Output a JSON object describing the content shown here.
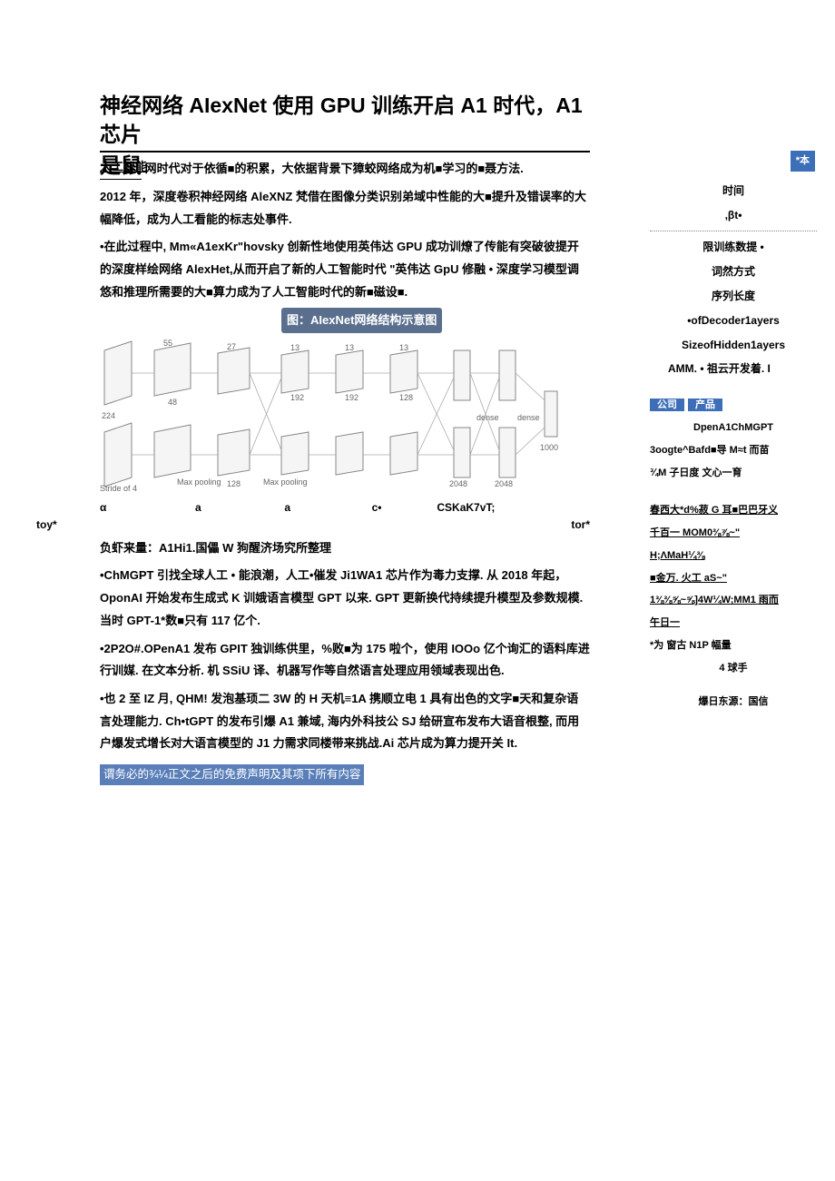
{
  "main": {
    "title": "神经网络 AIexNet 使用 GPU 训练开启 A1 时代，A1 芯片",
    "title2": "是鼠",
    "title2_overlay": "人工智能",
    "p1": "网时代对于依循■的积累，大依据背景下獐蛟网络成为机■学习的■聂方法.",
    "p2": "2012 年，深度卷积神经网络 AleXNZ 梵借在图像分类识别弟域中性能的大■提升及错误率的大幅降低，成为人工看能的标志处事件.",
    "p3": "•在此过程中, Mm«A1exKr\"hovsky 创新性地使用英伟达 GPU 成功训燎了传能有突破彼提开的深度样绘网络 AlexHet,从而开启了新的人工智能时代 \"英伟达 GpU 修融 • 深度学习模型调悠和推理所需要的大■算力成为了人工智能时代的新■磁设■.",
    "diagram_title": "图：AIexNet网络结构示意图",
    "tensor_row1": {
      "c1": "toy*",
      "c2": "α",
      "c3": "a",
      "c4": "a",
      "c5": "c•",
      "c6": "CSKaK7vT;",
      "c7": "tor*"
    },
    "source": "负虾来量：A1Hi1.国儡 W 狗醒济场究所整理",
    "p4": "•ChMGPT 引找全球人工 • 能浪潮，人工•催发 Ji1WA1 芯片作为毒力支撑. 从 2018 年起，OponAI 开始发布生成式 K 训娥语言模型 GPT 以来. GPT 更新换代持续提升模型及参数规模. 当时 GPT-1*数■只有 117 亿个.",
    "p5": "•2P2O#.OPenA1 发布 GPIT 独训练供里，%败■为 175 啦个，使用 IOOo 亿个询汇的语料库进行训媒. 在文本分析. 机 SSiU 译、机器写作等自然语言处理应用领域表现出色.",
    "p6": "•也 2 至 IZ 月, QHM! 发泡基顼二 3W 的 H 天机≡1A 携顺立电 1 具有出色的文字■天和复杂语言处理能力. Ch•tGPT 的发布引爆 A1 兼域, 海内外科技公 SJ 给研宣布发布大语音根整, 而用户爆发式增长对大语言模型的 J1 力需求同楼带来挑战.Ai 芯片成为算力提开关 It.",
    "highlight": "谓务必的¾¼正文之后的免费声明及其项下所有内容"
  },
  "sidebar": {
    "badge": "*本",
    "rows": [
      "时间",
      ",βt•"
    ],
    "after_divider": [
      "限训练数提 •",
      "词然方式",
      "序列长度"
    ],
    "bold_rows": [
      "•ofDecoder1ayers",
      "SizeofHidden1ayers"
    ],
    "amm": "AMM. • 祖云开发着. I",
    "header_cols": {
      "c1": "公司",
      "c2": "产品"
    },
    "table": [
      "DpenA1ChMGPT",
      "3oogte^Bafd■导 M≈t 而苗",
      "¾M 子日度  文心一育"
    ],
    "links": [
      "春西大*d%菽 G 耳■巴巴牙义",
      "千百一 MOM0⅜⅞~\"",
      "H;ΛMaH¼⅜",
      "■金万. 火工 aS~\"",
      "1⅜⅜⅝~⅝]4W¼W;MM1 雨而",
      "午日一"
    ],
    "footer_row": "*为        窗古 N1P 幅量",
    "footer_row2": "4 球手",
    "source": "爆日东源：国信"
  },
  "diagram_labels": {
    "stride": "Stride of 4",
    "maxpool": "Max pooling",
    "dense": "dense",
    "n48": "48",
    "n55": "55",
    "n27": "27",
    "n128": "128",
    "n192": "192",
    "n13": "13",
    "n2048": "2048",
    "n1000": "1000",
    "n224": "224"
  }
}
